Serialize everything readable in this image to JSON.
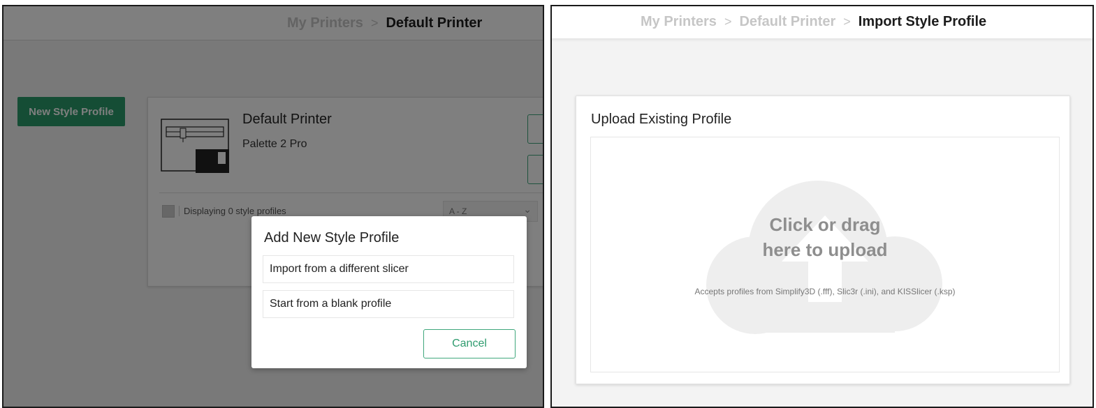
{
  "left": {
    "breadcrumb": {
      "root": "My Printers",
      "separator": ">",
      "current": "Default Printer"
    },
    "new_style_profile_label": "New Style Profile",
    "printer": {
      "name": "Default Printer",
      "model": "Palette 2 Pro"
    },
    "displaying_text": "Displaying 0 style profiles",
    "sort_value": "A - Z",
    "modal": {
      "title": "Add New Style Profile",
      "options": [
        "Import from a different slicer",
        "Start from a blank profile"
      ],
      "cancel_label": "Cancel"
    }
  },
  "right": {
    "breadcrumb": {
      "root": "My Printers",
      "separator": ">",
      "middle": "Default Printer",
      "current": "Import Style Profile"
    },
    "upload": {
      "title": "Upload Existing Profile",
      "line1": "Click or drag",
      "line2": "here to upload",
      "note": "Accepts profiles from Simplify3D (.fff), Slic3r (.ini), and KISSlicer (.ksp)"
    }
  },
  "icons": [
    "printer-illustration-icon",
    "chevron-down-icon",
    "upload-cloud-icon"
  ],
  "colors": {
    "accent": "#2a9a6a",
    "overlay": "rgba(0,0,0,0.5)"
  }
}
